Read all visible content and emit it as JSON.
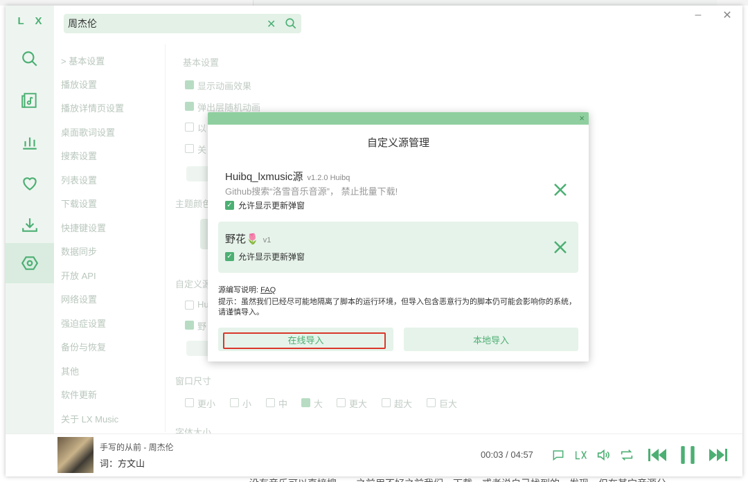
{
  "app": {
    "logo": "L X"
  },
  "search": {
    "value": "周杰伦"
  },
  "settings_nav": [
    "> 基本设置",
    "播放设置",
    "播放详情页设置",
    "桌面歌词设置",
    "搜索设置",
    "列表设置",
    "下载设置",
    "快捷键设置",
    "数据同步",
    "开放 API",
    "网络设置",
    "强迫症设置",
    "备份与恢复",
    "其他",
    "软件更新",
    "关于 LX Music"
  ],
  "settings_body": {
    "section_basic": "基本设置",
    "opt_anim": "显示动画效果",
    "opt_popup": "弹出层随机动画",
    "opt_partial_1": "以",
    "opt_partial_2": "关",
    "section_theme": "主题颜色",
    "section_custom": "自定义源",
    "custom_item_1": "Hu",
    "custom_item_2": "野",
    "section_window": "窗口尺寸",
    "window_sizes": [
      "更小",
      "小",
      "中",
      "大",
      "更大",
      "超大",
      "巨大"
    ],
    "section_font": "字体大小"
  },
  "modal": {
    "close": "×",
    "title": "自定义源管理",
    "sources": [
      {
        "name": "Huibq_lxmusic源",
        "version": "v1.2.0 Huibq",
        "description": "Github搜索“洛雪音乐音源”， 禁止批量下载!",
        "check_label": "允许显示更新弹窗"
      },
      {
        "name": "野花🌷",
        "version": "v1",
        "description": "",
        "check_label": "允许显示更新弹窗"
      }
    ],
    "doc_prefix": "源编写说明:",
    "doc_link": "FAQ",
    "warning": "提示：虽然我们已经尽可能地隔离了脚本的运行环境，但导入包含恶意行为的脚本仍可能会影响你的系统，请谨慎导入。",
    "btn_online": "在线导入",
    "btn_local": "本地导入"
  },
  "player": {
    "title": "手写的从前 - 周杰伦",
    "lyric": "词：方文山",
    "time": "00:03 / 04:57"
  },
  "bottom_text": "没有音乐可以直接搜…，之前用不好之前我们…下载…或者说自己找到的…发现…但在其它音源分…",
  "colors": {
    "accent": "#4caf73",
    "highlight": "#d9372a"
  }
}
